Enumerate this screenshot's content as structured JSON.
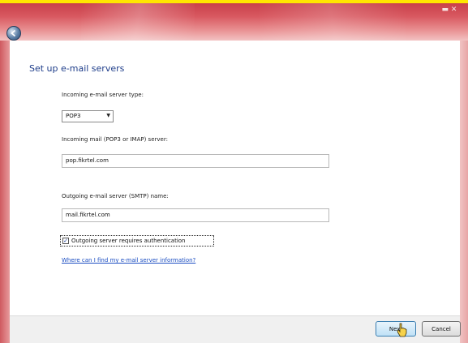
{
  "window": {
    "title_bar_glyph": "▬ ✕",
    "back_icon": "back-arrow-icon"
  },
  "page": {
    "title": "Set up e-mail servers"
  },
  "form": {
    "incoming_type_label": "Incoming e-mail server type:",
    "incoming_type_value": "POP3",
    "incoming_type_arrow": "▼",
    "incoming_server_label": "Incoming mail (POP3 or IMAP) server:",
    "incoming_server_value": "pop.fikrtel.com",
    "outgoing_server_label": "Outgoing e-mail server (SMTP) name:",
    "outgoing_server_value": "mail.fikrtel.com",
    "auth_checked_glyph": "✓",
    "auth_label": "Outgoing server requires authentication",
    "help_link": "Where can I find my e-mail server information?"
  },
  "buttons": {
    "next": "Next",
    "cancel": "Cancel"
  },
  "colors": {
    "title_bar": "#c8404a",
    "heading": "#1e3d8a",
    "link": "#1a4dc2",
    "highlight_bar": "#ffe600"
  }
}
